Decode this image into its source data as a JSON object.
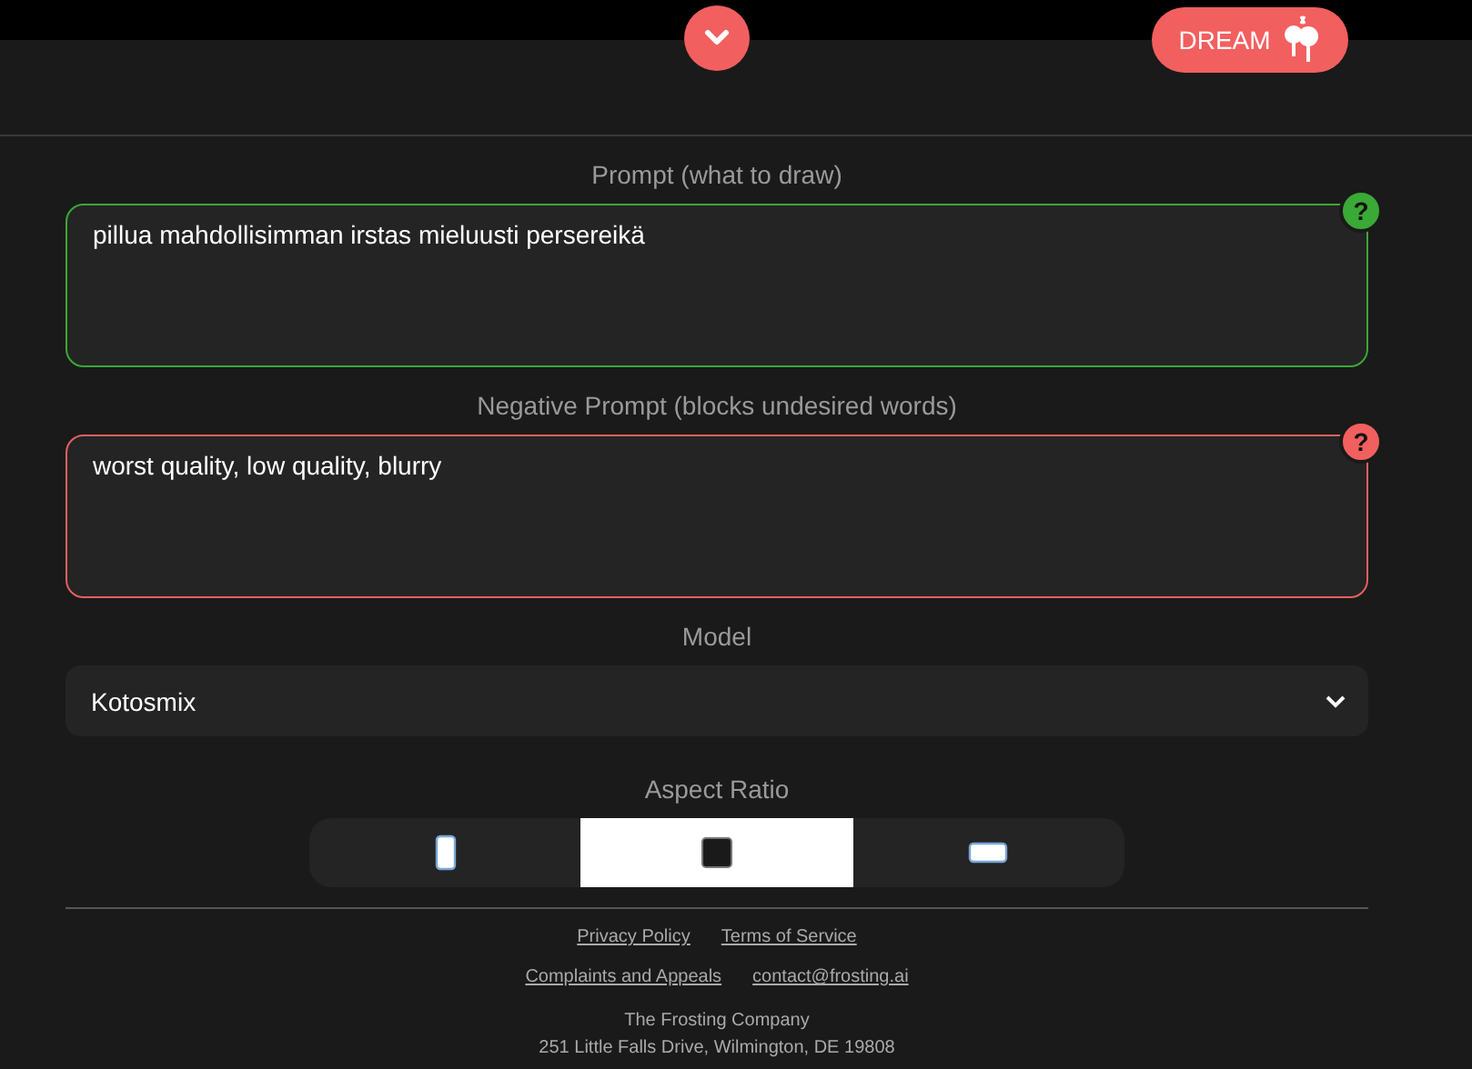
{
  "header": {
    "dream_button": "DREAM"
  },
  "prompt": {
    "label": "Prompt (what to draw)",
    "value": "pillua mahdollisimman irstas mieluusti persereikä",
    "help": "?"
  },
  "negative_prompt": {
    "label": "Negative Prompt (blocks undesired words)",
    "value": "worst quality, low quality, blurry",
    "help": "?"
  },
  "model": {
    "label": "Model",
    "value": "Kotosmix"
  },
  "aspect_ratio": {
    "label": "Aspect Ratio",
    "options": [
      {
        "kind": "portrait",
        "selected": false
      },
      {
        "kind": "square",
        "selected": true
      },
      {
        "kind": "landscape",
        "selected": false
      }
    ]
  },
  "footer": {
    "links": [
      [
        "Privacy Policy",
        "Terms of Service"
      ],
      [
        "Complaints and Appeals",
        "contact@frosting.ai"
      ]
    ],
    "company": "The Frosting Company",
    "address": "251 Little Falls Drive, Wilmington, DE 19808"
  }
}
